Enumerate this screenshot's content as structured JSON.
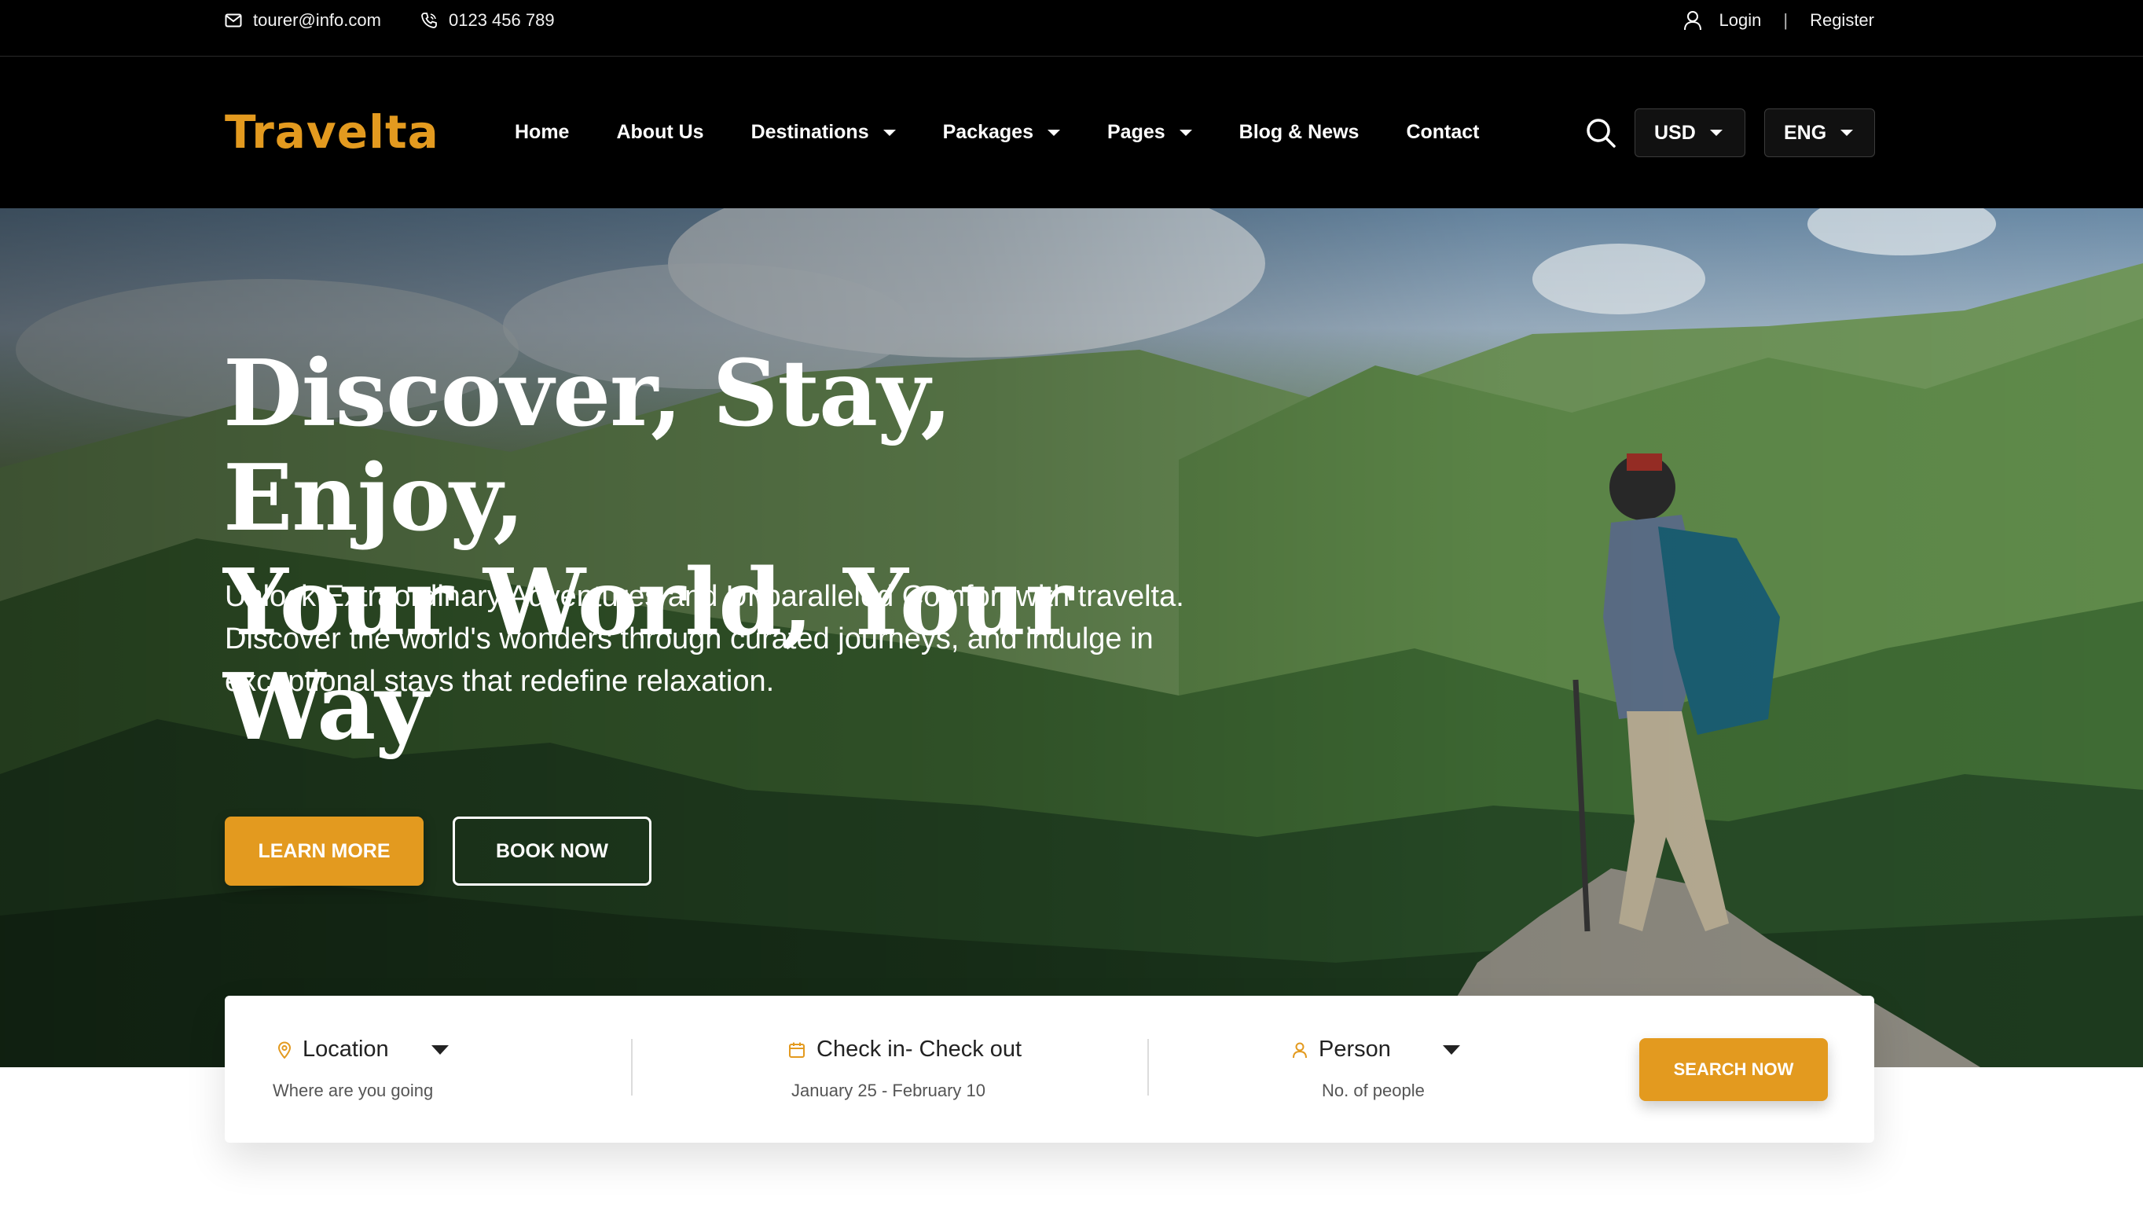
{
  "topbar": {
    "email": "tourer@info.com",
    "phone": "0123 456 789",
    "login": "Login",
    "separator": "|",
    "register": "Register"
  },
  "header": {
    "logo": "Travelta",
    "nav": [
      {
        "label": "Home",
        "has_dropdown": false
      },
      {
        "label": "About Us",
        "has_dropdown": false
      },
      {
        "label": "Destinations",
        "has_dropdown": true
      },
      {
        "label": "Packages",
        "has_dropdown": true
      },
      {
        "label": "Pages",
        "has_dropdown": true
      },
      {
        "label": "Blog & News",
        "has_dropdown": false
      },
      {
        "label": "Contact",
        "has_dropdown": false
      }
    ],
    "currency": "USD",
    "language": "ENG"
  },
  "hero": {
    "title_line1": "Discover, Stay, Enjoy,",
    "title_line2": "Your World, Your Way",
    "description": "Unlock Extraordinary Adventures and Unparalleled Comfort with travelta. Discover the world's wonders through curated journeys, and indulge in exceptional stays that redefine relaxation.",
    "learn_more": "LEARN MORE",
    "book_now": "BOOK NOW"
  },
  "booking": {
    "location_label": "Location",
    "location_sub": "Where are you going",
    "dates_label": "Check in- Check out",
    "dates_sub": "January 25 - February 10",
    "person_label": "Person",
    "person_sub": "No. of people",
    "search_button": "SEARCH NOW"
  },
  "colors": {
    "accent": "#E39A1F",
    "header_bg": "#000000"
  },
  "icons": [
    "mail-icon",
    "phone-icon",
    "user-icon",
    "search-icon",
    "location-pin-icon",
    "calendar-icon",
    "person-icon"
  ]
}
